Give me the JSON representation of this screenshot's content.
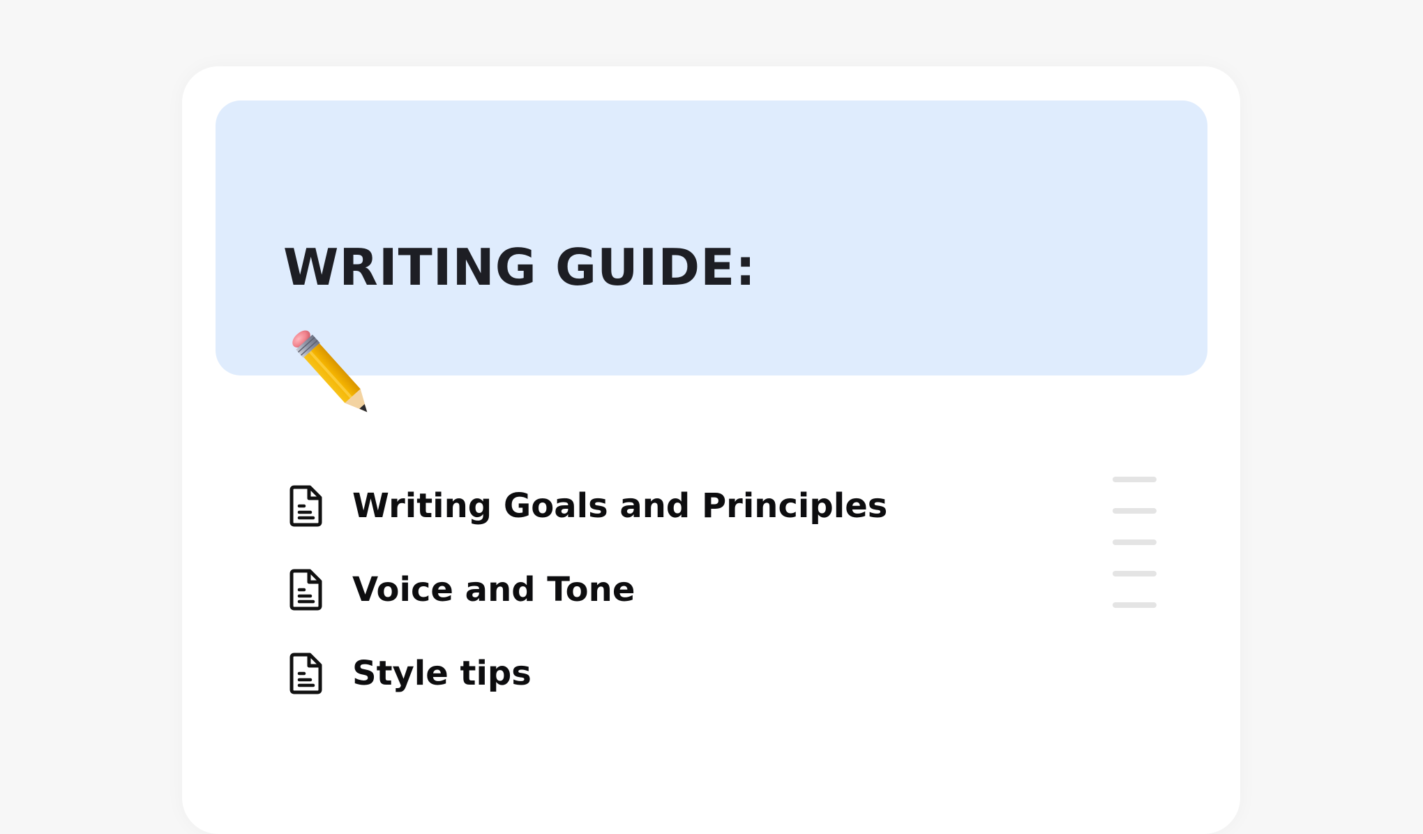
{
  "page": {
    "title": "WRITING GUIDE:",
    "icon": "pencil-icon",
    "cover_color": "#dfecfd"
  },
  "documents": [
    {
      "label": "Writing Goals and Principles",
      "icon": "document-icon"
    },
    {
      "label": "Voice and Tone",
      "icon": "document-icon"
    },
    {
      "label": "Style tips",
      "icon": "document-icon"
    }
  ],
  "table_of_contents": {
    "entries": 5,
    "color": "#e4e4e4"
  }
}
